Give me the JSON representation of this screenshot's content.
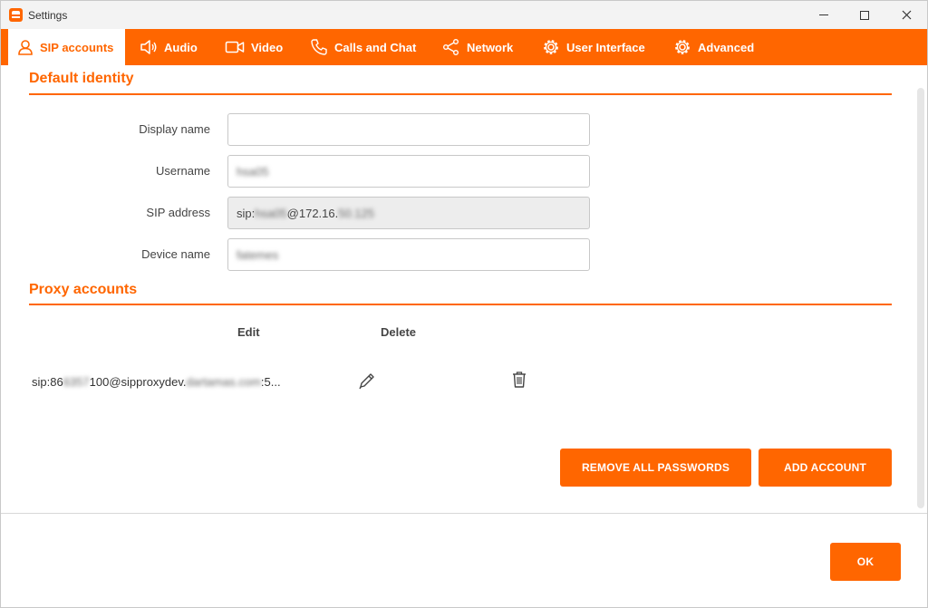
{
  "window": {
    "title": "Settings"
  },
  "tabs": [
    {
      "label": "SIP accounts",
      "icon": "user-icon",
      "active": true
    },
    {
      "label": "Audio",
      "icon": "speaker-icon"
    },
    {
      "label": "Video",
      "icon": "video-camera-icon"
    },
    {
      "label": "Calls and Chat",
      "icon": "phone-icon"
    },
    {
      "label": "Network",
      "icon": "share-icon"
    },
    {
      "label": "User Interface",
      "icon": "gear-icon"
    },
    {
      "label": "Advanced",
      "icon": "gear-icon"
    }
  ],
  "default_identity": {
    "title": "Default identity",
    "display_name_label": "Display name",
    "display_name_value": "",
    "username_label": "Username",
    "username_value": "hsa05",
    "sip_address_label": "SIP address",
    "sip_address_prefix": "sip:",
    "sip_address_user": "hsa05",
    "sip_address_host": "@172.16.",
    "sip_address_host_tail": "50.125",
    "device_name_label": "Device name",
    "device_name_value": "fatemes"
  },
  "proxy_accounts": {
    "title": "Proxy accounts",
    "edit_header": "Edit",
    "delete_header": "Delete",
    "rows": [
      {
        "address_prefix": "sip:86",
        "address_blur1": "6357",
        "address_mid": "100@sipproxydev.",
        "address_blur2": "dartamas.com",
        "address_tail": ":5..."
      }
    ]
  },
  "buttons": {
    "remove_all_passwords": "REMOVE ALL PASSWORDS",
    "add_account": "ADD ACCOUNT",
    "ok": "OK"
  },
  "colors": {
    "accent": "#ff6600",
    "background": "#ffffff"
  }
}
